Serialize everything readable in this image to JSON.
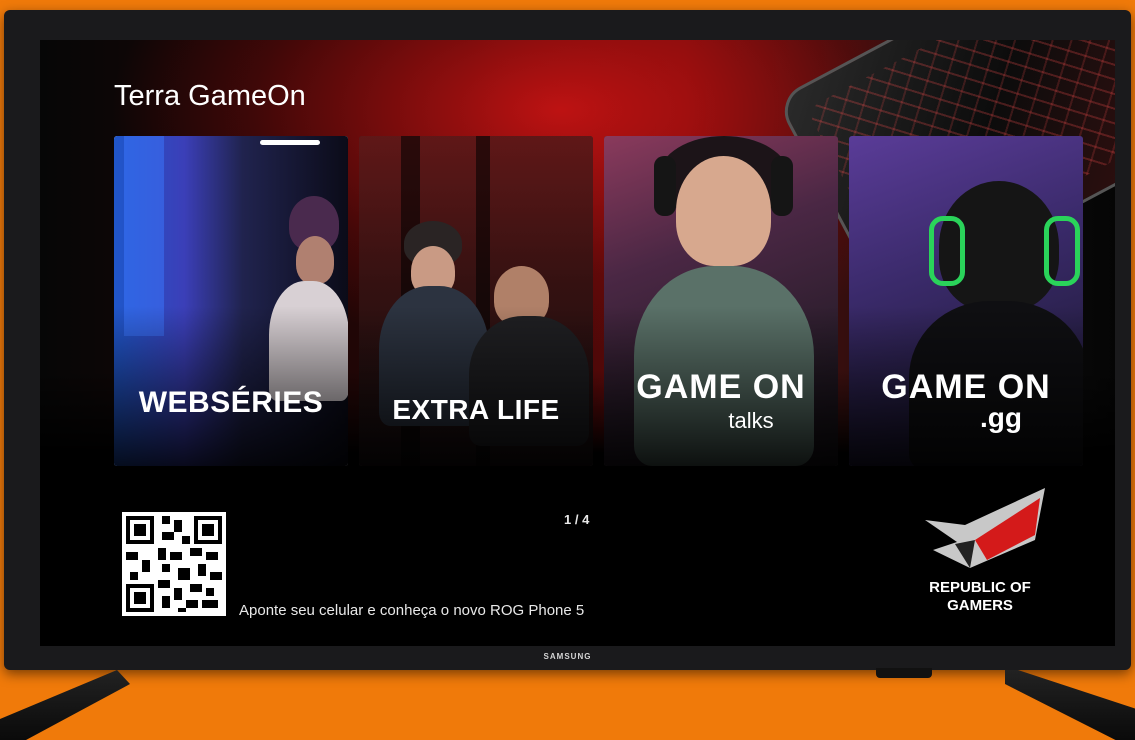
{
  "app": {
    "title": "Terra GameOn"
  },
  "cards": [
    {
      "label": "WEBSÉRIES",
      "sub": "",
      "focused": true
    },
    {
      "label": "EXTRA LIFE",
      "sub": "",
      "focused": false
    },
    {
      "label": "GAME ON",
      "sub": "talks",
      "focused": false
    },
    {
      "label": "GAME ON",
      "sub": ".gg",
      "focused": false
    }
  ],
  "pager": {
    "text": "1 / 4"
  },
  "qr": {
    "caption": "Aponte seu celular e conheça o novo ROG Phone 5"
  },
  "rog_logo": {
    "line1": "REPUBLIC OF",
    "line2": "GAMERS"
  },
  "tv": {
    "brand": "SAMSUNG"
  },
  "colors": {
    "background": "#f07a0a",
    "accent": "#d41a1a",
    "focus": "#e6e6e6"
  }
}
